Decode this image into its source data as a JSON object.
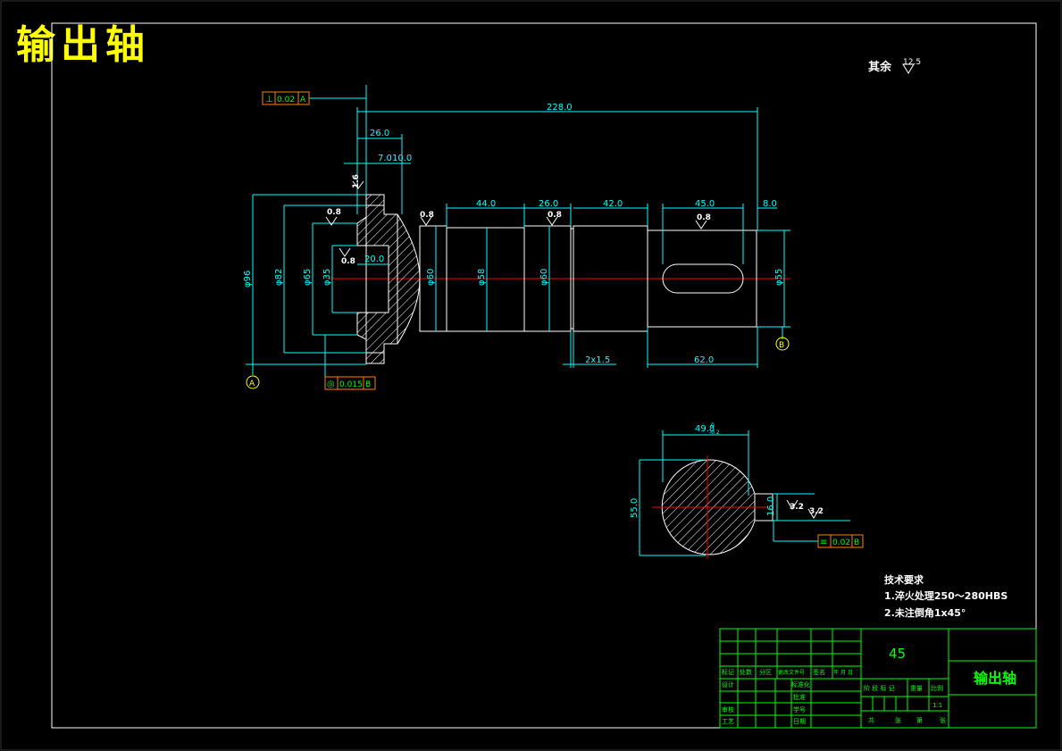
{
  "page_title": "输出轴",
  "surface_note": {
    "text": "其余",
    "roughness": "12.5"
  },
  "roughness_marks": [
    "0.8",
    "0.8",
    "1.6",
    "0.8",
    "0.8",
    "0.8",
    "3.2",
    "3.2"
  ],
  "dimensions": {
    "overall_length": "228.0",
    "flange_width": "26.0",
    "flange_step": "7.0",
    "flange_step2": "10.0",
    "seg_44": "44.0",
    "seg_26": "26.0",
    "seg_42": "42.0",
    "keyway_len": "45.0",
    "end_8": "8.0",
    "bore_depth": "20.0",
    "groove": "2x1.5",
    "end_len": "62.0",
    "dia_96": "φ96",
    "dia_82": "φ82",
    "dia_65": "φ65",
    "dia_35": "φ35",
    "dia_60a": "φ60",
    "dia_58": "φ58",
    "dia_60b": "φ60",
    "dia_55": "φ55",
    "sec_width": "49.8",
    "sec_tol_upper": "0",
    "sec_tol_lower": "-0.2",
    "sec_dia": "55.0",
    "key_width": "16.0"
  },
  "tolerances": {
    "perp": {
      "symbol": "⊥",
      "value": "0.02",
      "datum": "A"
    },
    "runout": {
      "symbol": "◎",
      "value": "0.015",
      "datum": "B"
    },
    "sym": {
      "symbol": "≡",
      "value": "0.02",
      "datum": "B"
    }
  },
  "datums": [
    "A",
    "B"
  ],
  "tech_requirements": {
    "title": "技术要求",
    "items": [
      "1.淬火处理250～280HBS",
      "2.未注倒角1x45°"
    ]
  },
  "title_block": {
    "material": "45",
    "part_name": "输出轴",
    "scale": "1:1",
    "row_headers": [
      "标记",
      "处数",
      "分区",
      "更改文件号",
      "签名",
      "年 月 日"
    ],
    "left_labels": [
      "设计",
      "审核",
      "工艺"
    ],
    "mid_labels": [
      "标准化",
      "批准",
      "学号",
      "日期"
    ],
    "right_headers": [
      "阶 段 标 记",
      "重量",
      "比例"
    ],
    "sheet": [
      "共",
      "张",
      "第",
      "张"
    ]
  },
  "colors": {
    "frame": "#ffffff",
    "dimension": "#00ffff",
    "hatch": "#ffffff",
    "centerline": "#ff0000",
    "text_green": "#00ff00",
    "title_yellow": "#ffff00",
    "tolerance_box": "#ff8000"
  }
}
